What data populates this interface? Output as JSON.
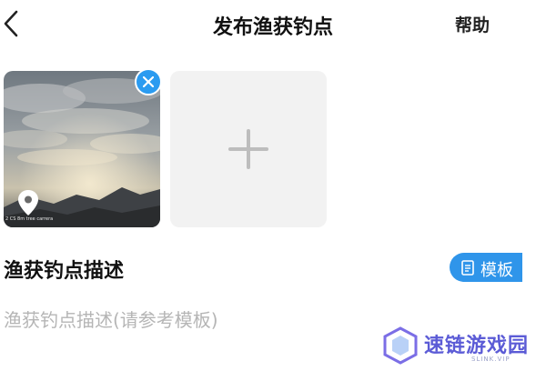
{
  "header": {
    "title": "发布渔获钓点",
    "help_label": "帮助"
  },
  "photos": [
    {
      "caption": "2 CS 8m  tree carrera"
    }
  ],
  "description": {
    "title": "渔获钓点描述",
    "template_label": "模板",
    "placeholder": "渔获钓点描述(请参考模板)"
  },
  "watermark": {
    "text": "速链游戏园",
    "sub": "SLINK.VIP"
  },
  "colors": {
    "accent": "#2f95ea",
    "close_badge": "#2b9bf0",
    "placeholder_text": "#b5b5b5",
    "add_tile_bg": "#f2f2f2"
  },
  "icons": {
    "back": "chevron-left-icon",
    "close": "close-icon",
    "location": "location-pin-icon",
    "add": "plus-icon",
    "template": "document-icon"
  }
}
